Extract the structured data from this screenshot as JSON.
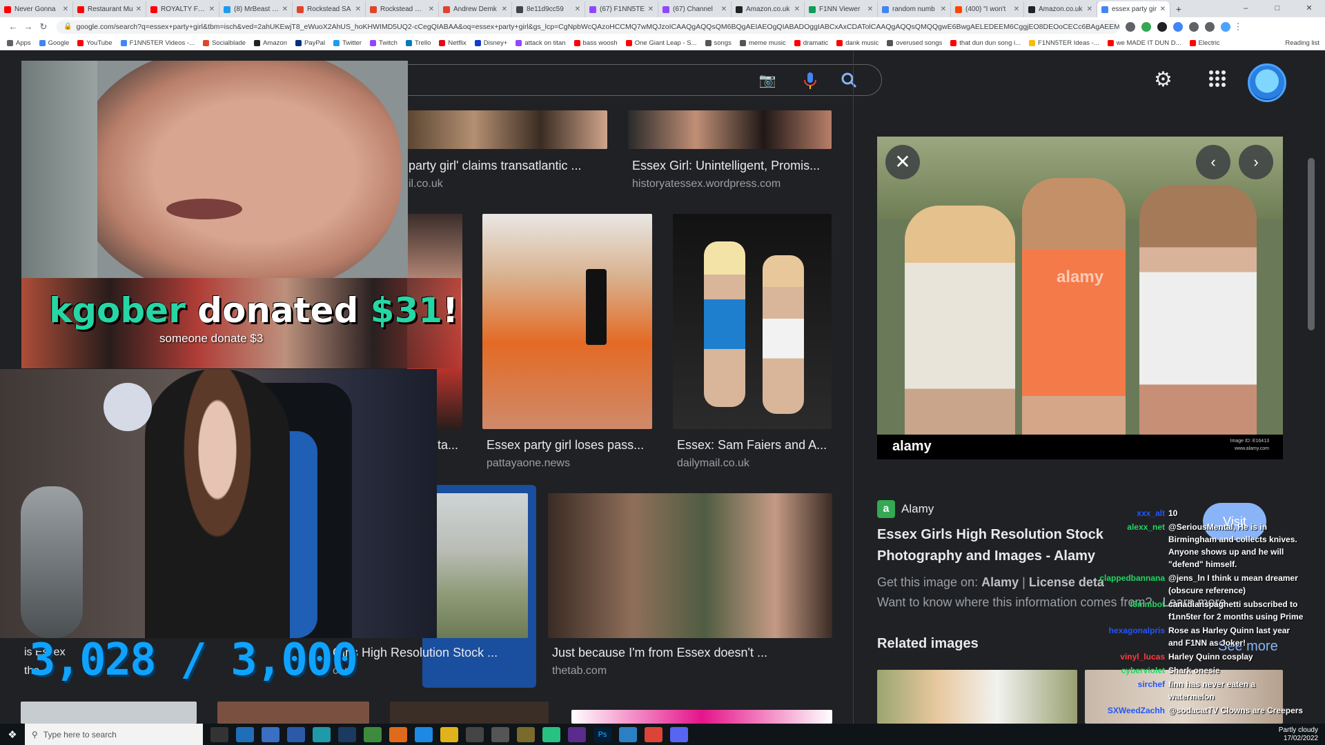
{
  "browser": {
    "tabs": [
      {
        "label": "Never Gonna",
        "color": "#ff0000"
      },
      {
        "label": "Restaurant Mu",
        "color": "#ff0000"
      },
      {
        "label": "ROYALTY FREE",
        "color": "#ff0000"
      },
      {
        "label": "(8) MrBeast on",
        "color": "#1d9bf0"
      },
      {
        "label": "Rockstead SA",
        "color": "#e0442a"
      },
      {
        "label": "Rockstead RYC",
        "color": "#e0442a"
      },
      {
        "label": "Andrew Demk",
        "color": "#e0442a"
      },
      {
        "label": "8e11d9cc59",
        "color": "#444444"
      },
      {
        "label": "(67) F1NN5TE",
        "color": "#9146ff"
      },
      {
        "label": "(67) Channel",
        "color": "#9146ff"
      },
      {
        "label": "Amazon.co.uk",
        "color": "#222222"
      },
      {
        "label": "F1NN Viewer",
        "color": "#0f9d58"
      },
      {
        "label": "random numb",
        "color": "#4285f4"
      },
      {
        "label": "(400) \"I won't",
        "color": "#ff4500"
      },
      {
        "label": "Amazon.co.uk",
        "color": "#222222"
      },
      {
        "label": "essex party gir",
        "color": "#4285f4"
      }
    ],
    "new_tab": "+",
    "url": "google.com/search?q=essex+party+girl&tbm=isch&ved=2ahUKEwjT8_eWuoX2AhUS_hoKHWIMD5UQ2-cCegQIABAA&oq=essex+party+girl&gs_lcp=CgNpbWcQAzoHCCMQ7wMQJzoICAAQgAQQsQM6BQgAEIAEOgQIABADOggIABCxAxCDATolCAAQgAQQsQMQQgwE6BwgAELEDEEM6CggjEO8DEOoCECc6BAgAEEM6BggAEAUQHg...",
    "bookmarks": [
      {
        "label": "Apps",
        "color": "#5f6368"
      },
      {
        "label": "Google",
        "color": "#4285f4"
      },
      {
        "label": "YouTube",
        "color": "#ff0000"
      },
      {
        "label": "F1NN5TER Videos -...",
        "color": "#4285f4"
      },
      {
        "label": "Socialblade",
        "color": "#e0442a"
      },
      {
        "label": "Amazon",
        "color": "#222222"
      },
      {
        "label": "PayPal",
        "color": "#003087"
      },
      {
        "label": "Twitter",
        "color": "#1d9bf0"
      },
      {
        "label": "Twitch",
        "color": "#9146ff"
      },
      {
        "label": "Trello",
        "color": "#0079bf"
      },
      {
        "label": "Netflix",
        "color": "#e50914"
      },
      {
        "label": "Disney+",
        "color": "#113ccf"
      },
      {
        "label": "attack on titan",
        "color": "#9146ff"
      },
      {
        "label": "bass woosh",
        "color": "#ff0000"
      },
      {
        "label": "One Giant Leap - S...",
        "color": "#ff0000"
      },
      {
        "label": "songs",
        "color": "#555555"
      },
      {
        "label": "meme music",
        "color": "#555555"
      },
      {
        "label": "dramatic",
        "color": "#ff0000"
      },
      {
        "label": "dank music",
        "color": "#ff0000"
      },
      {
        "label": "overused songs",
        "color": "#555555"
      },
      {
        "label": "that dun dun song i...",
        "color": "#ff0000"
      },
      {
        "label": "F1NN5TER Ideas -...",
        "color": "#fbbc04"
      },
      {
        "label": "we MADE IT DUN D...",
        "color": "#ff0000"
      },
      {
        "label": "Electric",
        "color": "#ff0000"
      }
    ],
    "reading_list": "Reading list"
  },
  "results": [
    {
      "title": "party girl' claims transatlantic ...",
      "source": "il.co.uk"
    },
    {
      "title": "Essex Girl: Unintelligent, Promis...",
      "source": "historyatessex.wordpress.com"
    },
    {
      "title": "ta...",
      "source": ""
    },
    {
      "title": "Essex party girl loses pass...",
      "source": "pattayaone.news"
    },
    {
      "title": "Essex: Sam Faiers and A...",
      "source": "dailymail.co.uk"
    },
    {
      "title": "Girls High Resolution Stock ...",
      "source": "com"
    },
    {
      "title": "Just because I'm from Essex doesn't ...",
      "source": "thetab.com"
    }
  ],
  "panel": {
    "source_name": "Alamy",
    "source_icon": "a",
    "visit_label": "Visit",
    "title": "Essex Girls High Resolution Stock Photography and Images - Alamy",
    "get_prefix": "Get this image on:",
    "get_site": "Alamy",
    "license": "License deta",
    "want_to_know": "Want to know where this information comes from?",
    "learn_more": "Learn more",
    "related": "Related images",
    "see_more": "See more",
    "watermark": "alamy",
    "image_id": "Image ID: E16413",
    "image_site": "www.alamy.com"
  },
  "overlay": {
    "donor": "kgober",
    "donated_word": " donated ",
    "amount": "$31",
    "bang": "!",
    "donation_message": "someone donate $3",
    "sub_goal": "3,028 / 3,000",
    "ticker_line1": "is Essex",
    "ticker_line2": "the",
    "donor_color": "#26d6a4",
    "amount_color": "#26d6a4"
  },
  "chat": [
    {
      "user": "xxx_alt",
      "text": "10",
      "color": "#2255ff"
    },
    {
      "user": "alexx_net",
      "text": "@SeriousMental, He is in Birmingham and collects knives. Anyone shows up and he will \"defend\" himself.",
      "color": "#1ed760"
    },
    {
      "user": "clappedbannana",
      "text": "@jens_ln I think u mean dreamer (obscure reference)",
      "color": "#1ed760"
    },
    {
      "user": "f3mmbot",
      "text": "canadianspaghetti subscribed to f1nn5ter for 2 months using Prime",
      "color": "#1ed760"
    },
    {
      "user": "hexagonalpris",
      "text": "Rose as Harley Quinn last year and F1NN as Joker!",
      "color": "#2255ff"
    },
    {
      "user": "vinyl_lucas",
      "text": "Harley Quinn cosplay",
      "color": "#ff3b3b"
    },
    {
      "user": "cyberviolet",
      "text": "Shark onesie",
      "color": "#1ed760"
    },
    {
      "user": "sirchef",
      "text": "finn has never eaten a watermelon",
      "color": "#2255ff"
    },
    {
      "user": "SXWeedZachh",
      "text": "@sodacatTV Clowns are Creepers",
      "color": "#2255ff"
    }
  ],
  "taskbar": {
    "search_placeholder": "Type here to search",
    "clock_line1": "Partly cloudy",
    "clock_line2": "17/02/2022"
  }
}
